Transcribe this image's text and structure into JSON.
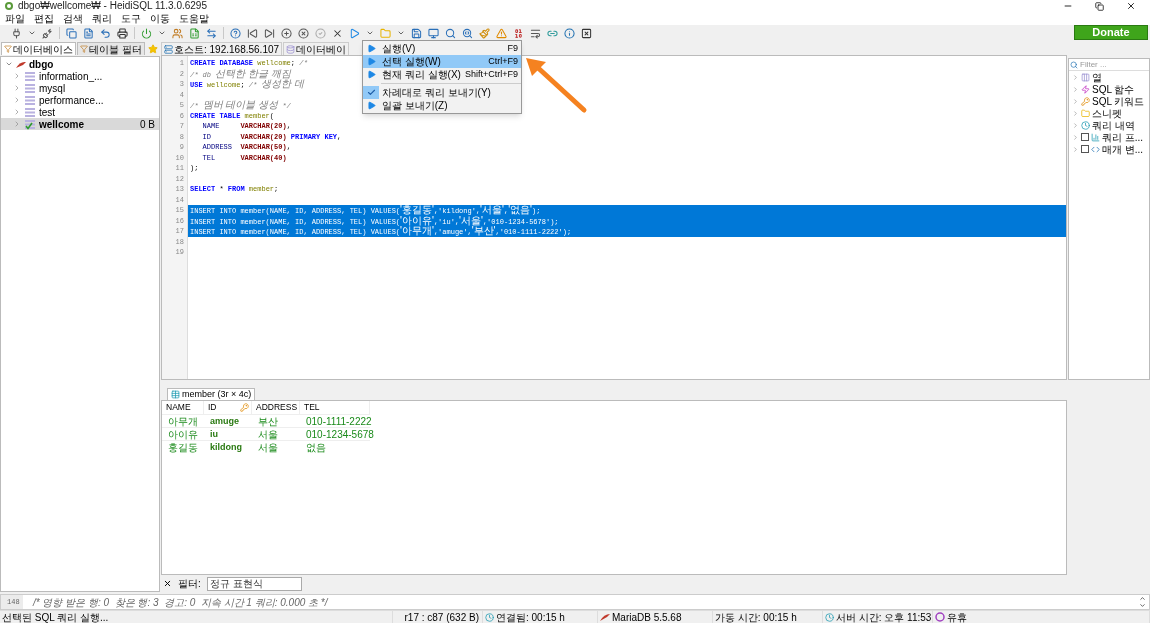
{
  "window": {
    "title": "dbgo₩wellcome₩ - HeidiSQL 11.3.0.6295"
  },
  "menu_bar": [
    "파일",
    "편집",
    "검색",
    "쿼리",
    "도구",
    "이동",
    "도움말"
  ],
  "donate_button": "Donate",
  "left_tabs": [
    {
      "label": "데이터베이스",
      "selected": true
    },
    {
      "label": "테이블 필터",
      "selected": false
    }
  ],
  "tree": {
    "label": "dbgo",
    "expanded": true,
    "children": [
      {
        "label": "information_...",
        "expanded": false,
        "selected": false
      },
      {
        "label": "mysql",
        "expanded": false,
        "selected": false
      },
      {
        "label": "performance...",
        "expanded": false,
        "selected": false
      },
      {
        "label": "test",
        "expanded": false,
        "selected": false
      },
      {
        "label": "wellcome",
        "size": "0 B",
        "expanded": false,
        "selected": true
      }
    ]
  },
  "query_tabs": [
    "호스트: 192.168.56.107",
    "데이터베이"
  ],
  "editor": {
    "lines": [
      {
        "number": "1",
        "selected": false,
        "tokens": [
          {
            "kind": "keyword",
            "text": "CREATE DATABASE "
          },
          {
            "kind": "identifier",
            "text": "wellcome"
          },
          {
            "kind": "plain",
            "text": "; "
          },
          {
            "kind": "comment",
            "text": "/*"
          }
        ]
      },
      {
        "number": "2",
        "selected": false,
        "tokens": [
          {
            "kind": "comment",
            "text": "/* db "
          },
          {
            "kind": "comment-hangul",
            "text": "선택한 한글 깨짐"
          }
        ]
      },
      {
        "number": "3",
        "selected": false,
        "tokens": [
          {
            "kind": "keyword",
            "text": "USE "
          },
          {
            "kind": "identifier",
            "text": "wellcome"
          },
          {
            "kind": "plain",
            "text": "; "
          },
          {
            "kind": "comment",
            "text": "/* "
          },
          {
            "kind": "comment-hangul",
            "text": "생성한 데"
          }
        ]
      },
      {
        "number": "4",
        "selected": false
      },
      {
        "number": "5",
        "selected": false,
        "tokens": [
          {
            "kind": "comment",
            "text": "/* "
          },
          {
            "kind": "comment-hangul",
            "text": "멤버 테이블 생성"
          },
          {
            "kind": "comment",
            "text": " */"
          }
        ]
      },
      {
        "number": "6",
        "selected": false,
        "tokens": [
          {
            "kind": "keyword",
            "text": "CREATE TABLE "
          },
          {
            "kind": "identifier",
            "text": "member"
          },
          {
            "kind": "plain",
            "text": "("
          }
        ]
      },
      {
        "number": "7",
        "selected": false,
        "tokens": [
          {
            "kind": "column",
            "text": "   NAME     "
          },
          {
            "kind": "type",
            "text": "VARCHAR(20)"
          },
          {
            "kind": "plain",
            "text": ","
          }
        ]
      },
      {
        "number": "8",
        "selected": false,
        "tokens": [
          {
            "kind": "column",
            "text": "   ID       "
          },
          {
            "kind": "type",
            "text": "VARCHAR(20) "
          },
          {
            "kind": "keyword",
            "text": "PRIMARY KEY"
          },
          {
            "kind": "plain",
            "text": ","
          }
        ]
      },
      {
        "number": "9",
        "selected": false,
        "tokens": [
          {
            "kind": "column",
            "text": "   ADDRESS  "
          },
          {
            "kind": "type",
            "text": "VARCHAR(50)"
          },
          {
            "kind": "plain",
            "text": ","
          }
        ]
      },
      {
        "number": "10",
        "selected": false,
        "tokens": [
          {
            "kind": "column",
            "text": "   TEL      "
          },
          {
            "kind": "type",
            "text": "VARCHAR(40)"
          }
        ]
      },
      {
        "number": "11",
        "selected": false,
        "tokens": [
          {
            "kind": "plain",
            "text": ");"
          }
        ]
      },
      {
        "number": "12",
        "selected": false
      },
      {
        "number": "13",
        "selected": false,
        "tokens": [
          {
            "kind": "keyword",
            "text": "SELECT"
          },
          {
            "kind": "plain",
            "text": " * "
          },
          {
            "kind": "keyword",
            "text": "FROM "
          },
          {
            "kind": "identifier",
            "text": "member"
          },
          {
            "kind": "plain",
            "text": ";"
          }
        ]
      },
      {
        "number": "14",
        "selected": false
      },
      {
        "number": "15",
        "selected": true,
        "tokens": [
          {
            "kind": "plain",
            "text": "INSERT INTO member(NAME, ID, ADDRESS, TEL) VALUES("
          },
          {
            "kind": "string-hangul",
            "text": "'홍길동'"
          },
          {
            "kind": "plain",
            "text": ",'kildong',"
          },
          {
            "kind": "string-hangul",
            "text": "'서울'"
          },
          {
            "kind": "plain",
            "text": ","
          },
          {
            "kind": "string-hangul",
            "text": "'없음'"
          },
          {
            "kind": "plain",
            "text": ");"
          }
        ]
      },
      {
        "number": "16",
        "selected": true,
        "tokens": [
          {
            "kind": "plain",
            "text": "INSERT INTO member(NAME, ID, ADDRESS, TEL) VALUES("
          },
          {
            "kind": "string-hangul",
            "text": "'아이유'"
          },
          {
            "kind": "plain",
            "text": ",'iu',"
          },
          {
            "kind": "string-hangul",
            "text": "'서울'"
          },
          {
            "kind": "plain",
            "text": ",'010-1234-5678');"
          }
        ]
      },
      {
        "number": "17",
        "selected": true,
        "tokens": [
          {
            "kind": "plain",
            "text": "INSERT INTO member(NAME, ID, ADDRESS, TEL) VALUES("
          },
          {
            "kind": "string-hangul",
            "text": "'아무개'"
          },
          {
            "kind": "plain",
            "text": ",'amuge',"
          },
          {
            "kind": "string-hangul",
            "text": "'부산'"
          },
          {
            "kind": "plain",
            "text": ",'010-1111-2222');"
          }
        ]
      },
      {
        "number": "18",
        "selected": false
      },
      {
        "number": "19",
        "selected": false
      }
    ]
  },
  "run_menu": {
    "items": [
      {
        "kind": "item",
        "label": "실행(V)",
        "shortcut": "F9",
        "selected": false,
        "checked": false
      },
      {
        "kind": "item",
        "label": "선택 실행(W)",
        "shortcut": "Ctrl+F9",
        "selected": true,
        "checked": false
      },
      {
        "kind": "item",
        "label": "현재 쿼리 실행(X)",
        "shortcut": "Shift+Ctrl+F9",
        "selected": false,
        "checked": false
      },
      {
        "kind": "separator"
      },
      {
        "kind": "item",
        "label": "차례대로 쿼리 보내기(Y)",
        "selected": false,
        "checked": true
      },
      {
        "kind": "item",
        "label": "일괄 보내기(Z)",
        "selected": false,
        "checked": false
      }
    ]
  },
  "helper_panel": {
    "filter_placeholder": "Filter ...",
    "items": [
      {
        "kind": "plain",
        "label": "열",
        "expanded": false
      },
      {
        "kind": "plain",
        "label": "SQL 함수",
        "expanded": false
      },
      {
        "kind": "plain",
        "label": "SQL 키워드",
        "expanded": false
      },
      {
        "kind": "plain",
        "label": "스니펫",
        "expanded": false
      },
      {
        "kind": "plain",
        "label": "쿼리 내역",
        "expanded": false
      },
      {
        "kind": "checkbox",
        "label": "쿼리 프...",
        "expanded": false,
        "checked": false
      },
      {
        "kind": "checkbox",
        "label": "매개 변...",
        "expanded": false,
        "checked": false
      }
    ]
  },
  "result": {
    "tab": "member (3r × 4c)",
    "columns": [
      {
        "label": "NAME",
        "key": false
      },
      {
        "label": "ID",
        "key": true
      },
      {
        "label": "ADDRESS",
        "key": false
      },
      {
        "label": "TEL",
        "key": false
      }
    ],
    "rows": [
      [
        "아무개",
        "amuge",
        "부산",
        "010-1111-2222"
      ],
      [
        "아이유",
        "iu",
        "서울",
        "010-1234-5678"
      ],
      [
        "홍길동",
        "kildong",
        "서울",
        "없음"
      ]
    ]
  },
  "filter": {
    "label": "필터:",
    "placeholder": "정규 표현식"
  },
  "log": {
    "line_number": "148",
    "text": "/* 영향 받은 행: 0  찾은 행: 3  경고: 0  지속 시간 1 쿼리: 0.000 초 */"
  },
  "status_bar": [
    "선택된 SQL 쿼리 실행...",
    "r17 : c87 (632 B)",
    "연결됨: 00:15 h",
    "MariaDB 5.5.68",
    "가동 시간: 00:15 h",
    "서버 시간: 오후 11:53",
    "유휴"
  ]
}
